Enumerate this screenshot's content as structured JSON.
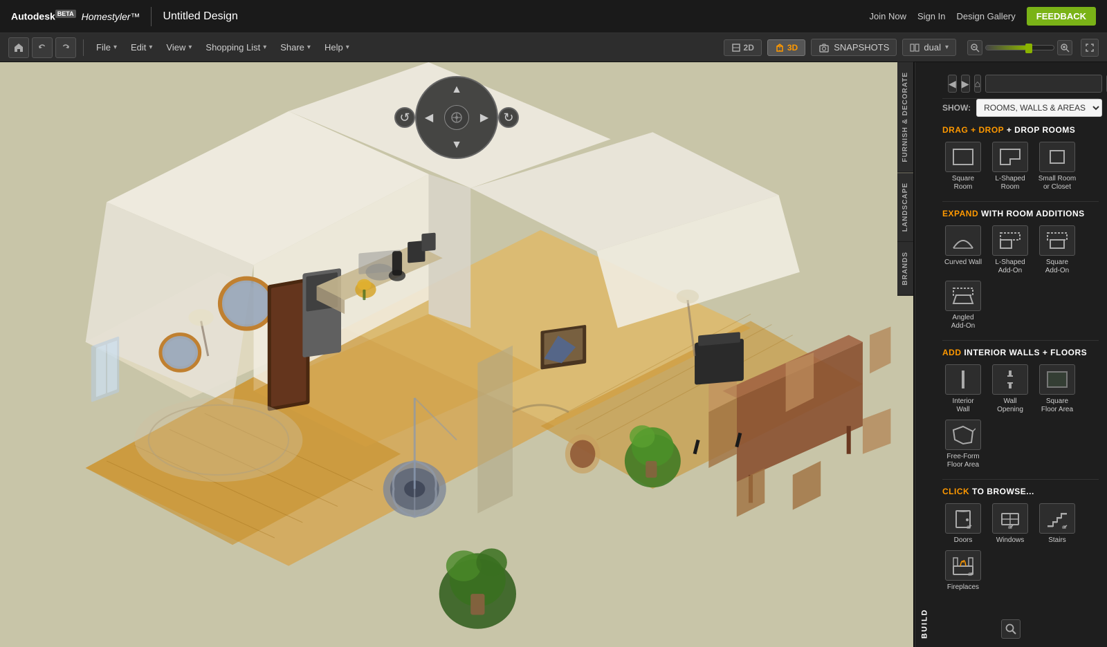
{
  "app": {
    "title": "Autodesk Homestyler",
    "beta_label": "BETA",
    "design_title": "Untitled Design"
  },
  "top_nav": {
    "join_now": "Join Now",
    "sign_in": "Sign In",
    "design_gallery": "Design Gallery",
    "feedback": "FEEDBACK"
  },
  "toolbar": {
    "file": "File",
    "edit": "Edit",
    "view": "View",
    "shopping_list": "Shopping List",
    "share": "Share",
    "help": "Help",
    "view_2d": "2D",
    "view_3d": "3D",
    "snapshots": "SNAPSHOTS",
    "dual": "dual"
  },
  "sidebar": {
    "show_label": "SHOW:",
    "show_value": "ROOMS, WALLS & AREAS",
    "vtabs": [
      "BUILD",
      "FURNISH & DECORATE",
      "LANDSCAPE",
      "BRANDS"
    ],
    "active_tab": "BUILD",
    "search_placeholder": "",
    "sections": {
      "drag_drop": {
        "prefix": "DRAG + DROP",
        "suffix": "ROOMS",
        "items": [
          {
            "id": "square-room",
            "label": "Square\nRoom"
          },
          {
            "id": "l-shaped-room",
            "label": "L-Shaped\nRoom"
          },
          {
            "id": "small-room-closet",
            "label": "Small Room\nor Closet"
          }
        ]
      },
      "expand": {
        "prefix": "EXPAND",
        "suffix": "WITH ROOM ADDITIONS",
        "items": [
          {
            "id": "curved-wall",
            "label": "Curved Wall"
          },
          {
            "id": "l-shaped-addon",
            "label": "L-Shaped\nAdd-On"
          },
          {
            "id": "square-addon",
            "label": "Square\nAdd-On"
          },
          {
            "id": "angled-addon",
            "label": "Angled\nAdd-On"
          }
        ]
      },
      "interior": {
        "prefix": "ADD",
        "suffix": "INTERIOR WALLS + FLOORS",
        "items": [
          {
            "id": "interior-wall",
            "label": "Interior\nWall"
          },
          {
            "id": "wall-opening",
            "label": "Wall\nOpening"
          },
          {
            "id": "square-floor-area",
            "label": "Square\nFloor Area"
          },
          {
            "id": "free-form-floor-area",
            "label": "Free-Form\nFloor Area"
          }
        ]
      },
      "browse": {
        "prefix": "CLICK",
        "suffix": "TO BROWSE...",
        "items": [
          {
            "id": "doors",
            "label": "Doors"
          },
          {
            "id": "windows",
            "label": "Windows"
          },
          {
            "id": "stairs",
            "label": "Stairs"
          },
          {
            "id": "fireplaces",
            "label": "Fireplaces"
          }
        ]
      }
    }
  }
}
